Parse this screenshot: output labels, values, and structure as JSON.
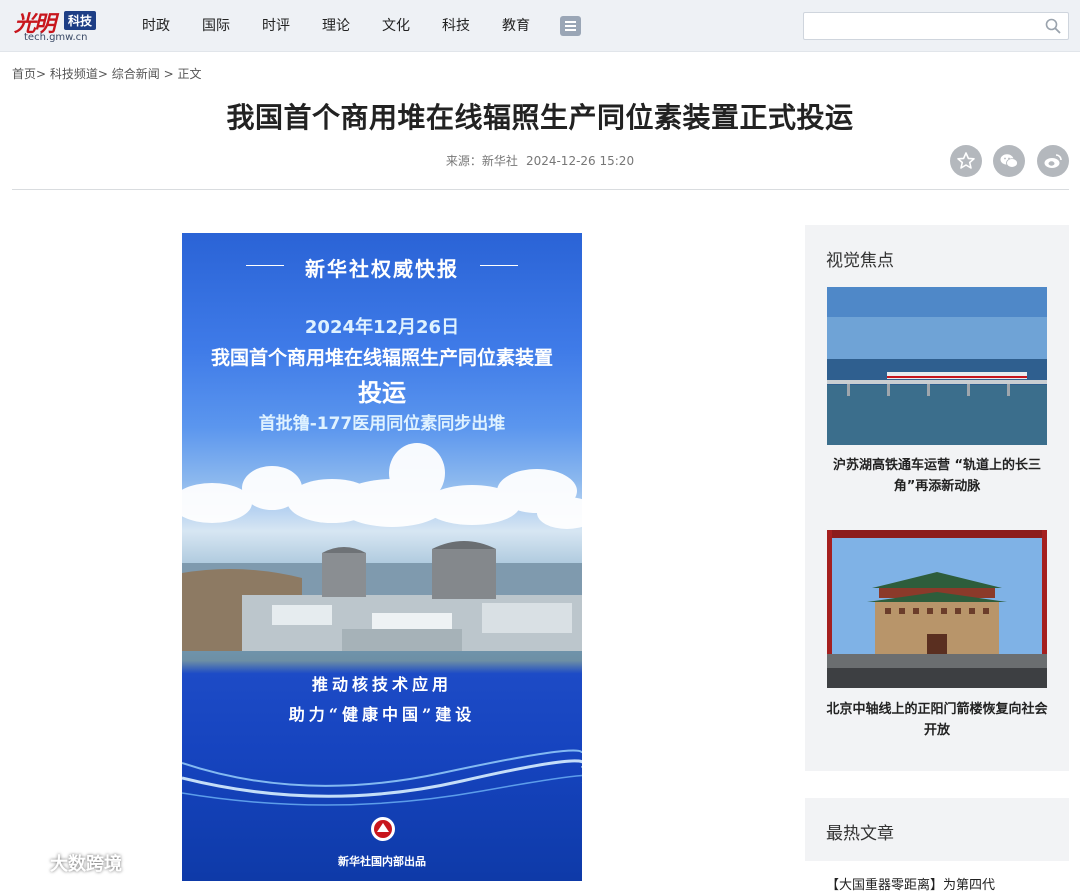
{
  "header": {
    "logo_main": "光明",
    "logo_tag": "科技",
    "logo_url": "tech.gmw.cn",
    "nav": [
      "时政",
      "国际",
      "时评",
      "理论",
      "文化",
      "科技",
      "教育"
    ],
    "search_placeholder": ""
  },
  "breadcrumb": {
    "items": [
      "首页>",
      "科技频道>",
      "综合新闻",
      ">",
      "正文"
    ]
  },
  "article": {
    "title": "我国首个商用堆在线辐照生产同位素装置正式投运",
    "source_label": "来源：新华社",
    "datetime": "2024-12-26 15:20"
  },
  "share": [
    "star-icon",
    "wechat-icon",
    "weibo-icon"
  ],
  "poster": {
    "header": "新华社权威快报",
    "date": "2024年12月26日",
    "title_line1": "我国首个商用堆在线辐照生产同位素装置",
    "title_line2": "投运",
    "subtitle": "首批镥-177医用同位素同步出堆",
    "slogan_line1": "推动核技术应用",
    "slogan_line2": "助力“健康中国”建设",
    "footer": "新华社国内部出品"
  },
  "sidebar": {
    "visual_focus_title": "视觉焦点",
    "cards": [
      {
        "caption": "沪苏湖高铁通车运营 “轨道上的长三角”再添新动脉"
      },
      {
        "caption": "北京中轴线上的正阳门箭楼恢复向社会开放"
      }
    ],
    "hot_title": "最热文章",
    "hot_items": [
      "【大国重器零距离】为第四代"
    ]
  },
  "watermark": "大数跨境",
  "colors": {
    "header_bg": "#eef1f5",
    "logo_red": "#c8161d",
    "logo_blue": "#1d3e85",
    "sidebar_bg": "#f2f3f5",
    "poster_blue": "#1644bf"
  }
}
